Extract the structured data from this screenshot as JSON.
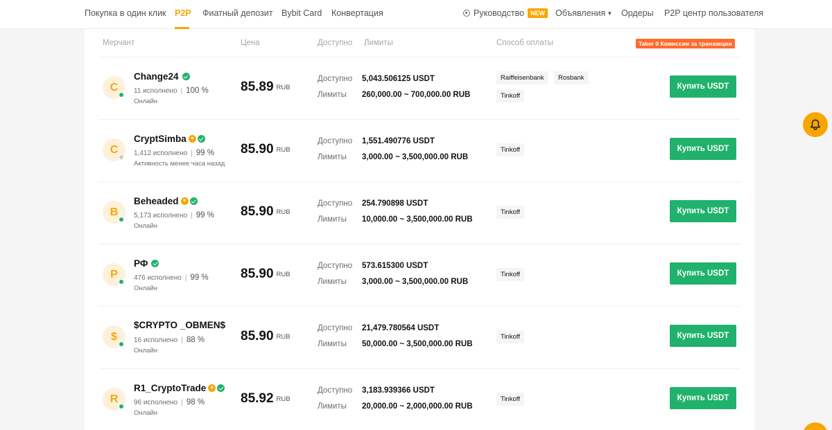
{
  "nav": {
    "items": [
      "Покупка в один клик",
      "P2P",
      "Фиатный депозит",
      "Bybit Card",
      "Конвертация"
    ],
    "guide_label": "Руководство",
    "new_badge": "NEW",
    "ads_label": "Объявления",
    "orders_label": "Ордеры",
    "user_center_label": "P2P центр пользователя",
    "accent_color": "#f7a600"
  },
  "table": {
    "headers": {
      "merchant": "Мерчант",
      "price": "Цена",
      "available": "Доступно",
      "limits": "Лимиты",
      "payment": "Способ оплаты"
    },
    "taker_badge": "Taker 0 Комиссии за транзакции",
    "available_label": "Доступно",
    "limits_label": "Лимиты",
    "buy_label": "Купить USDT",
    "currency": "RUB",
    "rows": [
      {
        "initial": "C",
        "name": "Change24",
        "gold_badge": false,
        "verified": true,
        "orders": "11 исполнено",
        "completion": "100 %",
        "status": "Онлайн",
        "online": true,
        "price": "85.89",
        "available": "5,043.506125 USDT",
        "limits": "260,000.00 ~ 700,000.00 RUB",
        "payments": [
          "Raiffeisenbank",
          "Rosbank",
          "Tinkoff"
        ]
      },
      {
        "initial": "C",
        "name": "CryptSimba",
        "gold_badge": true,
        "verified": true,
        "orders": "1,412 исполнено",
        "completion": "99 %",
        "status": "Активность менее часа назад",
        "online": false,
        "price": "85.90",
        "available": "1,551.490776 USDT",
        "limits": "3,000.00 ~ 3,500,000.00 RUB",
        "payments": [
          "Tinkoff"
        ]
      },
      {
        "initial": "B",
        "name": "Beheaded",
        "gold_badge": true,
        "verified": true,
        "orders": "5,173 исполнено",
        "completion": "99 %",
        "status": "Онлайн",
        "online": true,
        "price": "85.90",
        "available": "254.790898 USDT",
        "limits": "10,000.00 ~ 3,500,000.00 RUB",
        "payments": [
          "Tinkoff"
        ]
      },
      {
        "initial": "Р",
        "name": "РФ",
        "gold_badge": false,
        "verified": true,
        "orders": "476 исполнено",
        "completion": "99 %",
        "status": "Онлайн",
        "online": true,
        "price": "85.90",
        "available": "573.615300 USDT",
        "limits": "3,000.00 ~ 3,500,000.00 RUB",
        "payments": [
          "Tinkoff"
        ]
      },
      {
        "initial": "$",
        "name": "$CRYPTO _OBMEN$",
        "gold_badge": false,
        "verified": false,
        "orders": "16 исполнено",
        "completion": "88 %",
        "status": "Онлайн",
        "online": true,
        "price": "85.90",
        "available": "21,479.780564 USDT",
        "limits": "50,000.00 ~ 3,500,000.00 RUB",
        "payments": [
          "Tinkoff"
        ]
      },
      {
        "initial": "R",
        "name": "R1_CryptoTrade",
        "gold_badge": true,
        "verified": true,
        "orders": "96 исполнено",
        "completion": "98 %",
        "status": "Онлайн",
        "online": true,
        "price": "85.92",
        "available": "3,183.939366 USDT",
        "limits": "20,000.00 ~ 2,000,000.00 RUB",
        "payments": [
          "Tinkoff"
        ]
      }
    ]
  },
  "icons": {
    "guide": "guide-icon",
    "bell": "bell-icon",
    "verified": "verified-check-icon",
    "gold": "gold-merchant-icon"
  }
}
